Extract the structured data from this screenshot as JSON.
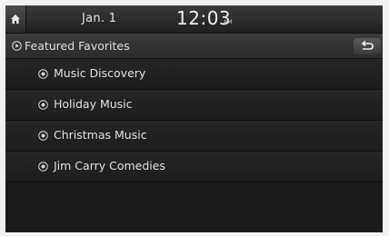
{
  "status": {
    "date": "Jan.  1",
    "time": "12:03",
    "ampm": "AM"
  },
  "title": {
    "label": "Featured Favorites",
    "icon": "play-circle-icon"
  },
  "list": [
    {
      "label": "Music Discovery",
      "icon": "bullet-circle-icon"
    },
    {
      "label": "Holiday Music",
      "icon": "bullet-circle-icon"
    },
    {
      "label": "Christmas Music",
      "icon": "bullet-circle-icon"
    },
    {
      "label": "Jim Carry Comedies",
      "icon": "bullet-circle-icon"
    }
  ],
  "colors": {
    "background": "#1b1b1b",
    "text": "#e0e0e0",
    "bar": "#3a3a3a"
  }
}
